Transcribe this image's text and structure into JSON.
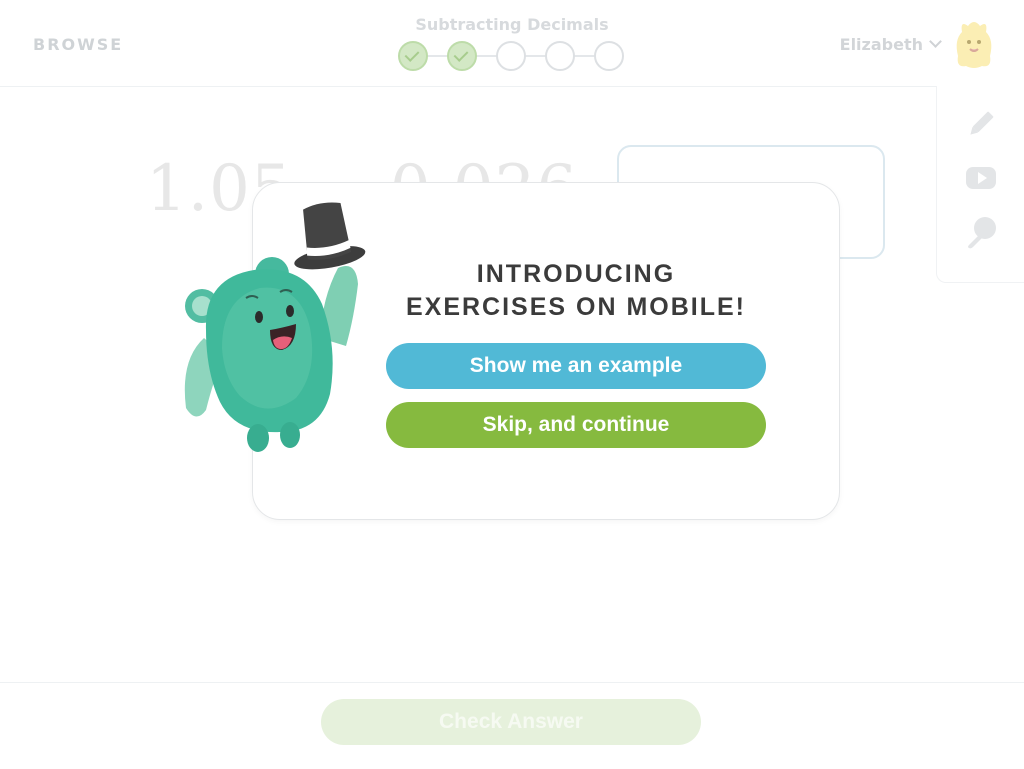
{
  "header": {
    "browse_label": "BROWSE",
    "lesson_title": "Subtracting Decimals",
    "progress": {
      "total_steps": 5,
      "completed_steps": 2
    },
    "user_name": "Elizabeth"
  },
  "exercise": {
    "problem": "1.05 − 0.026"
  },
  "modal": {
    "title_line1": "INTRODUCING",
    "title_line2": "EXERCISES ON MOBILE!",
    "primary_button": "Show me an example",
    "secondary_button": "Skip, and continue"
  },
  "footer": {
    "check_button": "Check Answer"
  },
  "tools": [
    "pencil-icon",
    "video-icon",
    "hint-icon"
  ],
  "colors": {
    "primary_button": "#51b9d6",
    "secondary_button": "#86ba3f",
    "mascot": "#3fb89a",
    "check_disabled": "#e6f1dc"
  }
}
